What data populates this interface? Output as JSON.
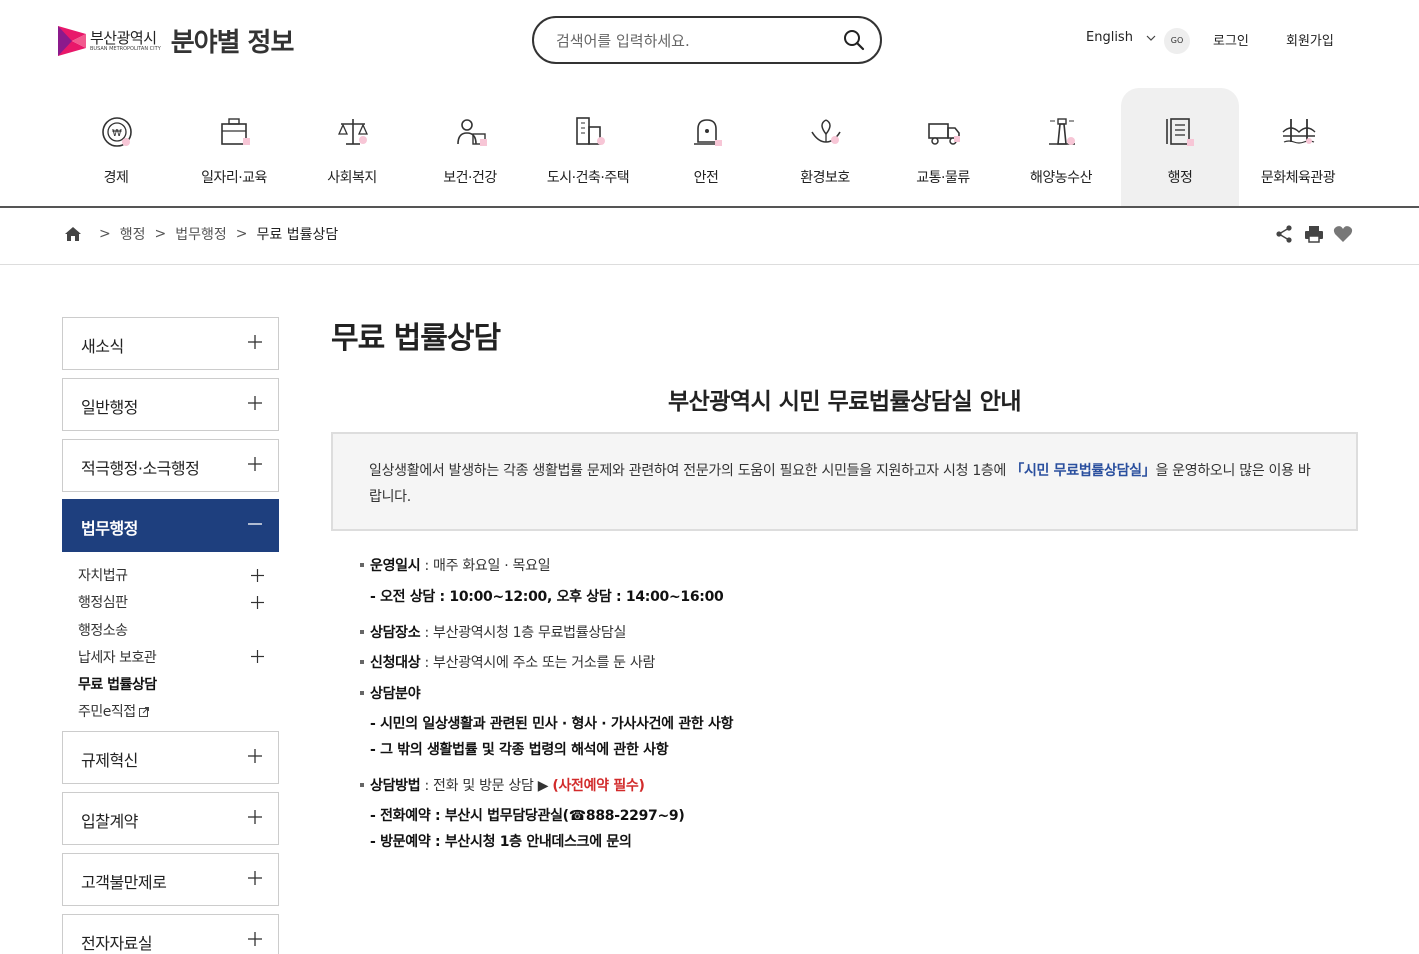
{
  "header": {
    "logo_name": "부산광역시",
    "logo_sub": "BUSAN METROPOLITAN CITY",
    "site_title": "분야별 정보",
    "search_placeholder": "검색어를 입력하세요.",
    "lang": "English",
    "go": "GO",
    "login": "로그인",
    "join": "회원가입"
  },
  "categories": [
    {
      "label": "경제",
      "icon": "economy-icon"
    },
    {
      "label": "일자리·교육",
      "icon": "job-icon"
    },
    {
      "label": "사회복지",
      "icon": "welfare-icon"
    },
    {
      "label": "보건·건강",
      "icon": "health-icon"
    },
    {
      "label": "도시·건축·주택",
      "icon": "building-icon"
    },
    {
      "label": "안전",
      "icon": "safety-icon"
    },
    {
      "label": "환경보호",
      "icon": "environment-icon"
    },
    {
      "label": "교통·물류",
      "icon": "truck-icon"
    },
    {
      "label": "해양농수산",
      "icon": "lighthouse-icon"
    },
    {
      "label": "행정",
      "icon": "document-icon"
    },
    {
      "label": "문화체육관광",
      "icon": "bridge-icon"
    }
  ],
  "breadcrumb": {
    "items": [
      "행정",
      "법무행정",
      "무료 법률상담"
    ],
    "sep": ">"
  },
  "sidebar": {
    "items": [
      "새소식",
      "일반행정",
      "적극행정·소극행정",
      "법무행정",
      "규제혁신",
      "입찰계약",
      "고객불만제로",
      "전자자료실"
    ],
    "subitems": [
      "자치법규",
      "행정심판",
      "행정소송",
      "납세자 보호관",
      "무료 법률상담",
      "주민e직접"
    ]
  },
  "main": {
    "page_title": "무료 법률상담",
    "section_title": "부산광역시 시민 무료법률상담실 안내",
    "intro_pre": "일상생활에서 발생하는 각종 생활법률 문제와 관련하여 전문가의 도움이 필요한 시민들을 지원하고자 시청 1층에 ",
    "intro_hl": "「시민 무료법률상담실」",
    "intro_post": "을 운영하오니 많은 이용 바랍니다.",
    "hours_label": "운영일시",
    "hours_value": "매주 화요일 · 목요일",
    "hours_detail": "- 오전 상담 : 10:00~12:00, 오후 상담 : 14:00~16:00",
    "place_label": "상담장소",
    "place_value": "부산광역시청 1층 무료법률상담실",
    "target_label": "신청대상",
    "target_value": "부산광역시에 주소 또는 거소를 둔 사람",
    "field_label": "상담분야",
    "field_1": "- 시민의 일상생활과 관련된 민사 · 형사 · 가사사건에 관한 사항",
    "field_2": "- 그 밖의 생활법률 및 각종 법령의 해석에 관한 사항",
    "method_label": "상담방법",
    "method_value": "전화 및 방문 상담 ▶",
    "method_note": "(사전예약 필수)",
    "method_1": "- 전화예약 : 부산시 법무담당관실(☎888-2297~9)",
    "method_2": "- 방문예약 : 부산시청 1층 안내데스크에 문의"
  },
  "colors": {
    "brand": "#1e3f7e",
    "accent_pink": "#e8186a",
    "highlight": "#2a4f9e",
    "warning": "#d22b2b"
  }
}
